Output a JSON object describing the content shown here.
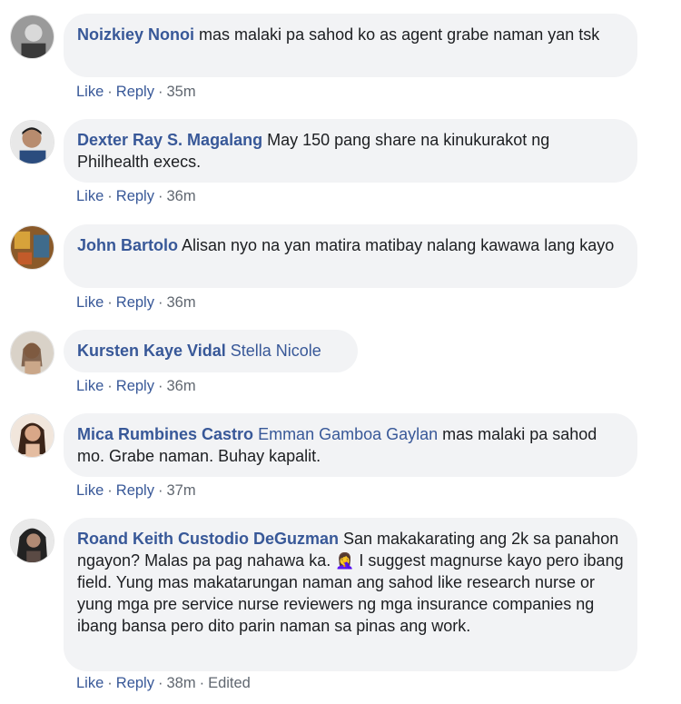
{
  "comments": [
    {
      "author": "Noizkiey Nonoi",
      "mention": "",
      "text": "mas malaki pa sahod ko as agent grabe naman yan tsk",
      "like": "Like",
      "reply": "Reply",
      "time": "35m"
    },
    {
      "author": "Dexter Ray S. Magalang",
      "mention": "",
      "text": "May 150 pang share na kinukurakot ng Philhealth execs.",
      "like": "Like",
      "reply": "Reply",
      "time": "36m"
    },
    {
      "author": "John Bartolo",
      "mention": "",
      "text": "Alisan nyo na yan matira matibay nalang kawawa lang kayo",
      "like": "Like",
      "reply": "Reply",
      "time": "36m"
    },
    {
      "author": "Kursten Kaye Vidal",
      "mention": "Stella Nicole",
      "text": "",
      "like": "Like",
      "reply": "Reply",
      "time": "36m"
    },
    {
      "author": "Mica Rumbines Castro",
      "mention": "Emman Gamboa Gaylan",
      "text": "mas malaki pa sahod mo. Grabe naman. Buhay kapalit.",
      "like": "Like",
      "reply": "Reply",
      "time": "37m"
    },
    {
      "author": "Roand Keith Custodio DeGuzman",
      "mention": "",
      "text_before_emoji": "San makakarating ang 2k sa panahon ngayon? Malas pa pag nahawa ka.",
      "emoji": "🤦‍♀️",
      "text_after_emoji": "I suggest magnurse kayo pero ibang field. Yung mas makatarungan naman ang sahod like research nurse or yung mga pre service nurse reviewers ng mga insurance companies ng ibang bansa pero dito parin naman sa pinas ang work.",
      "like": "Like",
      "reply": "Reply",
      "time": "38m",
      "edited": "Edited"
    }
  ],
  "colors": {
    "name": "#385898",
    "meta": "#606770",
    "bubble": "#f2f3f5"
  }
}
